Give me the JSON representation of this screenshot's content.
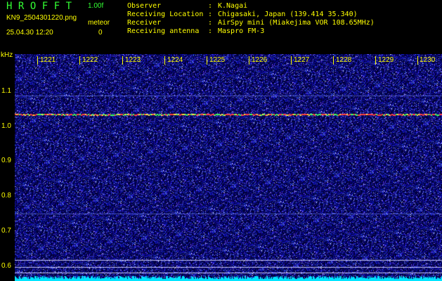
{
  "header": {
    "app_title": "HROFFT",
    "version": "1.00f",
    "file_name": "KN9_2504301220.png",
    "timestamp": "25.04.30 12:20",
    "meteor_label": "meteor",
    "meteor_count": "0"
  },
  "info": [
    {
      "key": "Observer",
      "sep": ":",
      "value": "K.Nagai"
    },
    {
      "key": "Receiving Location",
      "sep": ":",
      "value": "Chigasaki, Japan (139.414 35.340)"
    },
    {
      "key": "Receiver",
      "sep": ":",
      "value": "AirSpy mini (Miakejima VOR 108.65MHz)"
    },
    {
      "key": "Receiving antenna",
      "sep": ":",
      "value": "Maspro FM-3"
    }
  ],
  "axes": {
    "y_unit": "kHz",
    "y_ticks": [
      "1.1",
      "1.0",
      "0.9",
      "0.8",
      "0.7",
      "0.6"
    ],
    "x_ticks": [
      "1221",
      "1222",
      "1223",
      "1224",
      "1225",
      "1226",
      "1227",
      "1228",
      "1229",
      "1230"
    ]
  },
  "colors": {
    "background": "#000000",
    "text": "#ffff00",
    "title": "#33ff33",
    "noise_base": "#00003a",
    "noise_hot": "#3a3aff",
    "carrier": "#ff5050",
    "baseline": "#00e5ff"
  }
}
